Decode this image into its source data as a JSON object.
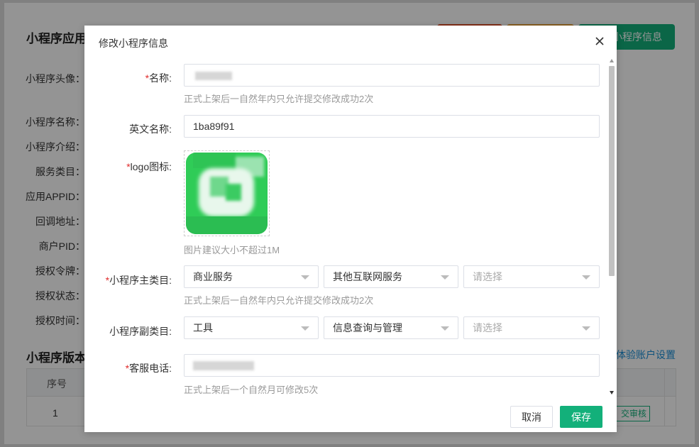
{
  "background": {
    "title": "小程序应用",
    "header_button": "小程序信息",
    "labels": [
      "小程序头像：",
      "小程序名称：",
      "小程序介绍：",
      "服务类目：",
      "应用APPID：",
      "回调地址：",
      "商户PID：",
      "授权令牌：",
      "授权状态：",
      "授权时间："
    ],
    "section_title": "小程序版本",
    "link": "体验账户设置",
    "table": {
      "header_col1": "序号",
      "row1_col1": "1",
      "action": "交审核"
    }
  },
  "dialog": {
    "title": "修改小程序信息",
    "name": {
      "label": "名称:",
      "hint": "正式上架后一自然年内只允许提交修改成功2次"
    },
    "en_name": {
      "label": "英文名称:",
      "value": "1ba89f91"
    },
    "logo": {
      "label": "logo图标:",
      "hint": "图片建议大小不超过1M"
    },
    "main_category": {
      "label": "小程序主类目:",
      "selects": [
        "商业服务",
        "其他互联网服务",
        "请选择"
      ],
      "hint": "正式上架后一自然年内只允许提交修改成功2次"
    },
    "sub_category": {
      "label": "小程序副类目:",
      "selects": [
        "工具",
        "信息查询与管理",
        "请选择"
      ]
    },
    "phone": {
      "label": "客服电话:",
      "hint": "正式上架后一个自然月可修改5次"
    },
    "footer": {
      "cancel": "取消",
      "save": "保存"
    }
  },
  "colors": {
    "accent": "#13b07a",
    "required": "#e02c2c",
    "link": "#1a8fd8"
  }
}
